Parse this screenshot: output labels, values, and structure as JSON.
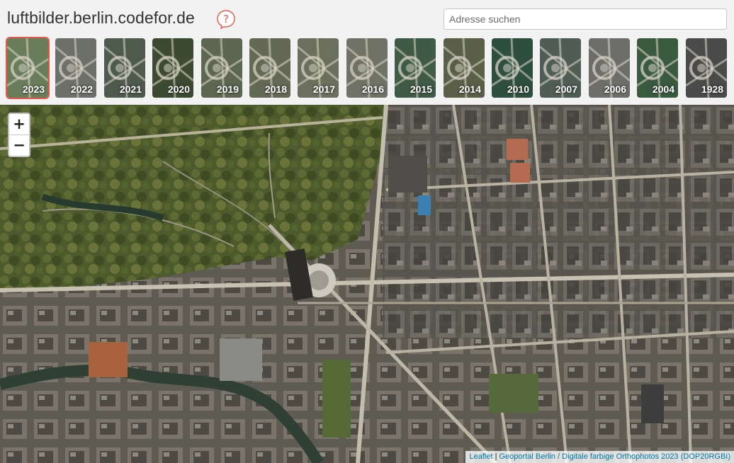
{
  "header": {
    "title": "luftbilder.berlin.codefor.de",
    "help_icon": "question-bubble-icon",
    "accent_color": "#e8574a"
  },
  "search": {
    "placeholder": "Adresse suchen",
    "value": ""
  },
  "years": [
    {
      "label": "2023",
      "active": true,
      "tone": "#6a7d5a"
    },
    {
      "label": "2022",
      "active": false,
      "tone": "#6d7068"
    },
    {
      "label": "2021",
      "active": false,
      "tone": "#4d5a4c"
    },
    {
      "label": "2020",
      "active": false,
      "tone": "#3d4a32"
    },
    {
      "label": "2019",
      "active": false,
      "tone": "#5c6650"
    },
    {
      "label": "2018",
      "active": false,
      "tone": "#636955"
    },
    {
      "label": "2017",
      "active": false,
      "tone": "#6b705e"
    },
    {
      "label": "2016",
      "active": false,
      "tone": "#6f7265"
    },
    {
      "label": "2015",
      "active": false,
      "tone": "#3f5a45"
    },
    {
      "label": "2014",
      "active": false,
      "tone": "#5a6048"
    },
    {
      "label": "2010",
      "active": false,
      "tone": "#2f4f3e"
    },
    {
      "label": "2007",
      "active": false,
      "tone": "#4f5d55"
    },
    {
      "label": "2006",
      "active": false,
      "tone": "#6d6d6a"
    },
    {
      "label": "2004",
      "active": false,
      "tone": "#3a5a40"
    },
    {
      "label": "1928",
      "active": false,
      "tone": "#4a4a4a"
    }
  ],
  "map": {
    "zoom_in": "+",
    "zoom_out": "−",
    "attribution": {
      "leaflet": "Leaflet",
      "separator": " | ",
      "source": "Geoportal Berlin / Digitale farbige Orthophotos 2023 (DOP20RGBI)"
    }
  }
}
